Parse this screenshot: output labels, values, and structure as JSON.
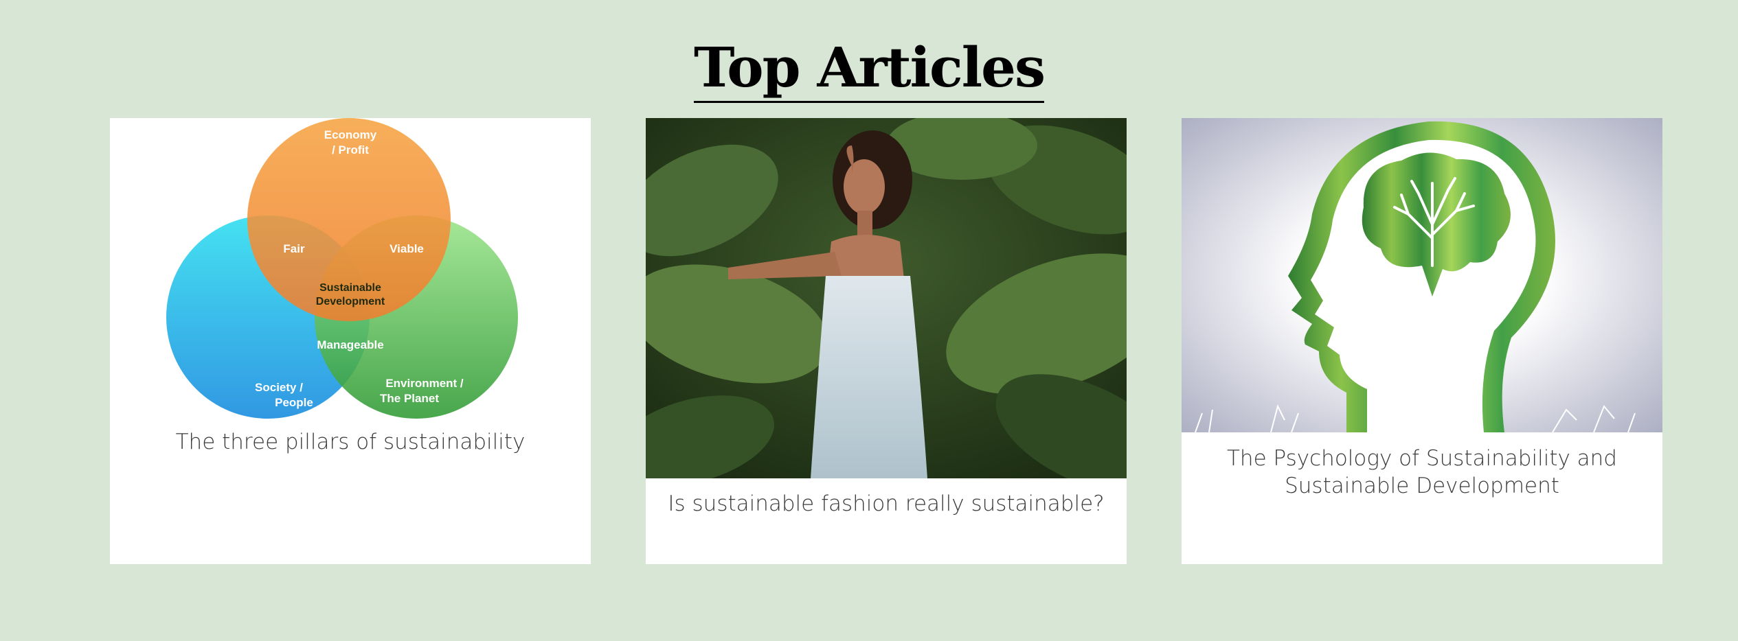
{
  "page": {
    "title": "Top Articles"
  },
  "articles": [
    {
      "caption": "The three pillars of sustainability",
      "image": {
        "kind": "venn-diagram",
        "labels": {
          "economy": [
            "Economy",
            "/ Profit"
          ],
          "society": [
            "Society /",
            "People"
          ],
          "environment": [
            "Environment /",
            "The Planet"
          ],
          "fair": "Fair",
          "viable": "Viable",
          "manageable": "Manageable",
          "center": [
            "Sustainable",
            "Development"
          ]
        }
      }
    },
    {
      "caption": "Is sustainable fashion really sustainable?",
      "image": {
        "kind": "photo",
        "subject": "woman-in-floral-dress-among-tropical-leaves"
      }
    },
    {
      "caption": "The Psychology of Sustainability and Sustainable Development",
      "image": {
        "kind": "illustration",
        "subject": "green-head-profile-with-tree-brain"
      }
    }
  ],
  "colors": {
    "background": "#d8e6d5",
    "card": "#ffffff",
    "economy": "#f39a3a",
    "society": "#2bb6ea",
    "environment": "#72cf62"
  }
}
